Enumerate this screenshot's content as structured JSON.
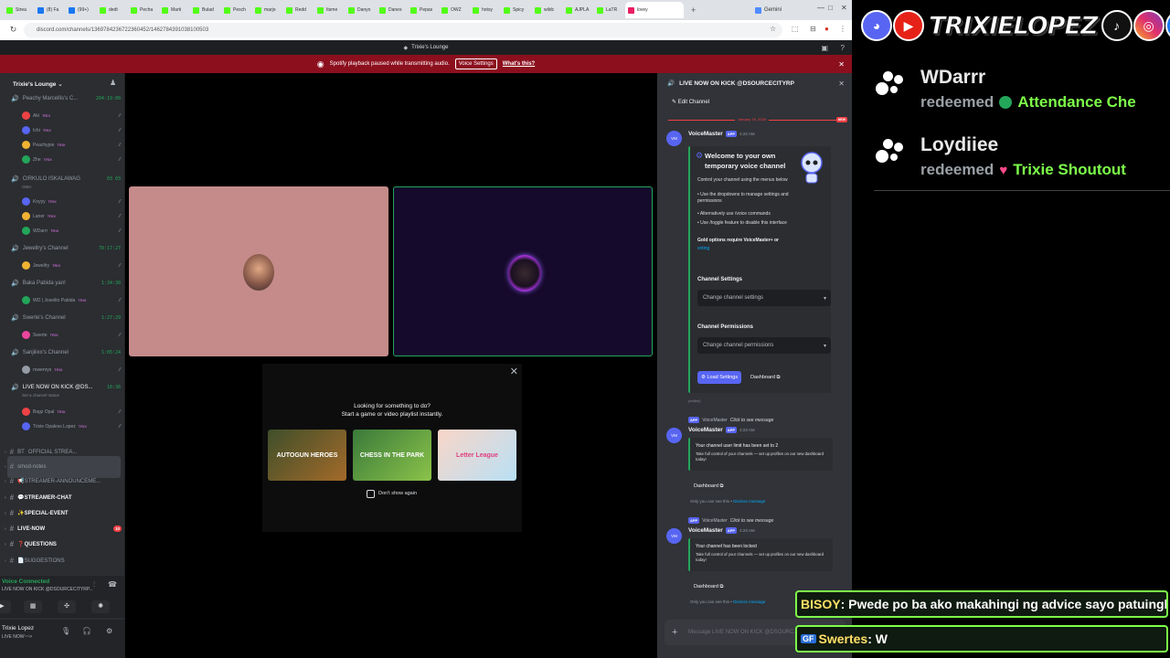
{
  "browser": {
    "tabs": [
      "Strea",
      "(8) Fa",
      "(99+)",
      "dedt",
      "Pecha",
      "Marti",
      "Bulad",
      "Pesch",
      "marjo",
      "Redd",
      "Itsme",
      "Danyo",
      "Danes",
      "Pepas",
      "OWZ",
      "hotsy",
      "Spicy",
      "wildc",
      "AJPLA",
      "LaTR",
      "lovey"
    ],
    "active_tab": "",
    "gemini_tab": "Gemini",
    "url": "discord.com/channels/1369784236722360452/1462784391038100503"
  },
  "discord": {
    "title": "Trixie's Lounge",
    "notice": {
      "text": "Spotify playback paused while transmitting audio.",
      "button": "Voice Settings",
      "link": "What's this?"
    },
    "server_name": "Trixie's Lounge",
    "voice_channels": [
      {
        "name": "Peachy Marcellis's C...",
        "time": "204:19:00",
        "users": [
          "Aki",
          "Ichi",
          "Peachypie",
          "Zhe"
        ]
      },
      {
        "name": "CIRKULO ISKALAWAG",
        "time": "03 03",
        "sub": "OMA",
        "users": [
          "Koyyy",
          "Laner",
          "WDarrr"
        ]
      },
      {
        "name": "Jewellry's Channel",
        "time": "78:17:27",
        "users": [
          "Jewellry"
        ]
      },
      {
        "name": "Baka Pabida yan!",
        "time": "1:34:30",
        "users": [
          "WD | Joselito Pabida"
        ]
      },
      {
        "name": "Swerte's Channel",
        "time": "1:27:29",
        "users": [
          "Swerte"
        ]
      },
      {
        "name": "Sanjiiixx's Channel",
        "time": "1:05:24",
        "users": [
          "rowenrys"
        ]
      },
      {
        "name": "LIVE NOW ON KICK @DS...",
        "time": "10:36",
        "sub": "Set a channel status",
        "users": [
          "Bagz Opal",
          "Trixie Opaless Lopez"
        ]
      }
    ],
    "twitch_tag": "TRIX",
    "text_channels": [
      {
        "name": "OFFICIAL STREA...",
        "prefix": "BT"
      },
      {
        "name": "smod-notes"
      },
      {
        "name": "📢STREAMER-ANNOUNCEME..."
      },
      {
        "name": "💬STREAMER-CHAT",
        "bold": true
      },
      {
        "name": "✨SPECIAL-EVENT",
        "bold": true
      },
      {
        "name": "LIVE-NOW",
        "bold": true,
        "badge": "10"
      },
      {
        "name": "❓QUESTIONS",
        "bold": true
      },
      {
        "name": "📄SUGGESTIONS"
      }
    ],
    "voice_connected": {
      "label": "Voice Connected",
      "channel": "LIVE NOW ON KICK @DSOURCECITYRP..."
    },
    "user": {
      "name": "Trixie Lopez",
      "status": "LIVE NOW~~>"
    },
    "activity": {
      "title": "Looking for something to do?",
      "subtitle": "Start a game or video playlist instantly.",
      "games": [
        "AUTOGUN HEROES",
        "CHESS IN THE PARK",
        "Letter League"
      ],
      "checkbox": "Don't show again"
    },
    "chat": {
      "header": "LIVE NOW ON KICK @DSOURCECITYRP",
      "edit": "Edit Channel",
      "date": "January 19, 2026",
      "new_badge": "NEW",
      "bot": "VoiceMaster",
      "app": "APP",
      "time1": "4:22 AM",
      "embed_title": "Welcome to your own temporary voice channel",
      "embed_lines": [
        "Control your channel using the menus below",
        "• Use the dropdowns to manage settings and permissions",
        "• Alternatively use /voice commands",
        "• Use /toggle feature to disable this interface",
        "Gold options require VoiceMaster+ or",
        "voting"
      ],
      "channel_settings": "Channel Settings",
      "dd1": "Change channel settings",
      "channel_permissions": "Channel Permissions",
      "dd2": "Change channel permissions",
      "load": "Load Settings",
      "dashboard": "Dashboard",
      "edited": "(edited)",
      "reply_text": "Click to see message",
      "time2": "4:23 AM",
      "msg2_l1": "Your channel user limit has been set to 2",
      "msg3_l1": "Your channel has been locked",
      "msg_l2": "Take full control of your channels — set up profiles on our new dashboard today!",
      "only": "Only you can see this •",
      "dismiss": "Dismiss message",
      "placeholder": "Message LIVE NOW ON KICK @DSOURC..."
    }
  },
  "overlay": {
    "brand": "TRIXIELOPEZ",
    "redeems": [
      {
        "user": "WDarrr",
        "verb": "redeemed",
        "reward": "Attendance Che",
        "color": "#23a55a"
      },
      {
        "user": "Loydiiee",
        "verb": "redeemed",
        "reward": "Trixie Shoutout",
        "color": "#ff4a8a"
      }
    ],
    "chat1": {
      "name": "BISOY",
      "text": " : Pwede po ba ako makahingi ng advice sayo patuingkol sa love ?"
    },
    "chat2": {
      "name": "Swertes",
      "text": " : W",
      "tag": "GF"
    }
  }
}
